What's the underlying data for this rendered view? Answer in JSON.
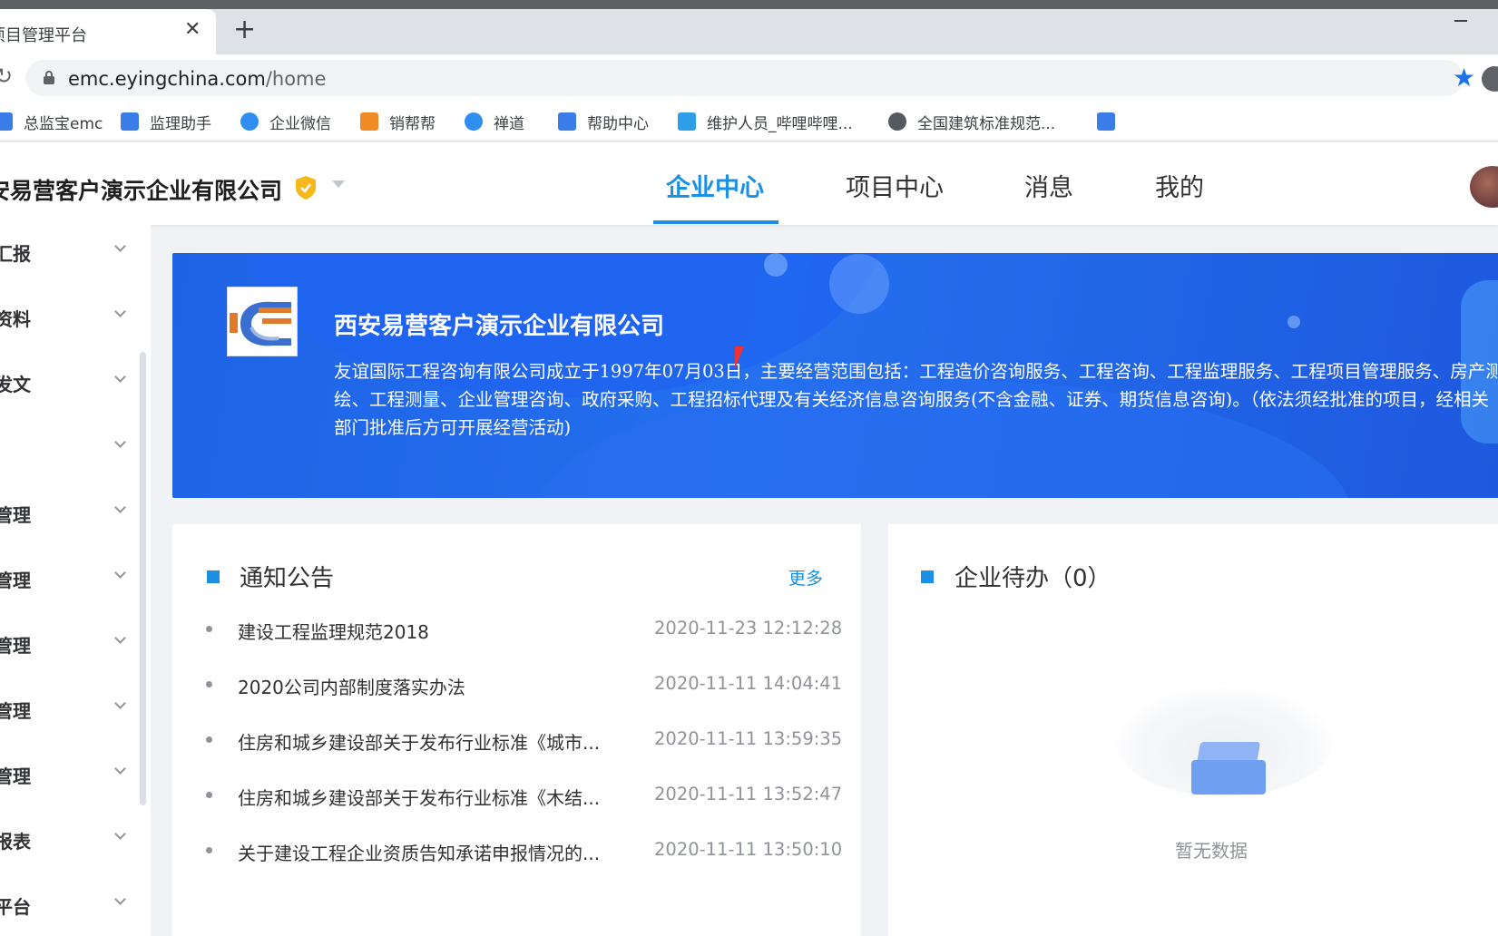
{
  "browser": {
    "tab_title": "项目管理平台",
    "tab_close": "✕",
    "new_tab": "+",
    "url_host": "emc.eyingchina.com",
    "url_path": "/home",
    "bookmarks": [
      {
        "label": "总监宝emc",
        "color": "#3b7de8"
      },
      {
        "label": "监理助手",
        "color": "#3b7de8"
      },
      {
        "label": "企业微信",
        "color": "#2f8ef0"
      },
      {
        "label": "销帮帮",
        "color": "#f08a24"
      },
      {
        "label": "禅道",
        "color": "#2f8ef0"
      },
      {
        "label": "帮助中心",
        "color": "#3b7de8"
      },
      {
        "label": "维护人员_哔哩哔哩...",
        "color": "#2f9ee8"
      },
      {
        "label": "全国建筑标准规范...",
        "color": "#555a60"
      },
      {
        "label": "",
        "color": "#3b7de8"
      }
    ]
  },
  "header": {
    "company": "安易营客户演示企业有限公司",
    "nav": [
      {
        "label": "企业中心",
        "active": true
      },
      {
        "label": "项目中心",
        "active": false
      },
      {
        "label": "消息",
        "active": false
      },
      {
        "label": "我的",
        "active": false
      }
    ]
  },
  "sidebar": {
    "items": [
      "汇报",
      "资料",
      "发文",
      "",
      "管理",
      "管理",
      "管理",
      "管理",
      "管理",
      "报表",
      "平台"
    ]
  },
  "banner": {
    "title": "西安易营客户演示企业有限公司",
    "description": "友谊国际工程咨询有限公司成立于1997年07月03日，主要经营范围包括：工程造价咨询服务、工程咨询、工程监理服务、工程项目管理服务、房产测绘、工程测量、企业管理咨询、政府采购、工程招标代理及有关经济信息咨询服务(不含金融、证券、期货信息咨询)。（依法须经批准的项目，经相关部门批准后方可开展经营活动)"
  },
  "notices": {
    "title": "通知公告",
    "more": "更多",
    "items": [
      {
        "title": "建设工程监理规范2018",
        "time": "2020-11-23 12:12:28"
      },
      {
        "title": "2020公司内部制度落实办法",
        "time": "2020-11-11 14:04:41"
      },
      {
        "title": "住房和城乡建设部关于发布行业标准《城市...",
        "time": "2020-11-11 13:59:35"
      },
      {
        "title": "住房和城乡建设部关于发布行业标准《木结...",
        "time": "2020-11-11 13:52:47"
      },
      {
        "title": "关于建设工程企业资质告知承诺申报情况的...",
        "time": "2020-11-11 13:50:10"
      }
    ]
  },
  "todo": {
    "title": "企业待办（0）",
    "empty_text": "暂无数据"
  },
  "colors": {
    "accent": "#1a8fe3",
    "banner": "#2470ef"
  }
}
